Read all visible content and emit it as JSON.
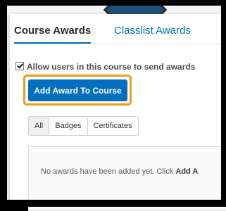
{
  "tabs": {
    "course_awards": "Course Awards",
    "classlist_awards": "Classlist Awards"
  },
  "settings": {
    "allow_label": "Allow users in this course to send awards",
    "allow_checked": true
  },
  "add_button_label": "Add Award To Course",
  "filters": [
    "All",
    "Badges",
    "Certificates"
  ],
  "empty_state": {
    "prefix": "No awards have been added yet. Click ",
    "link": "Add A"
  },
  "colors": {
    "accent": "#006fbf",
    "highlight": "#f39c12"
  }
}
